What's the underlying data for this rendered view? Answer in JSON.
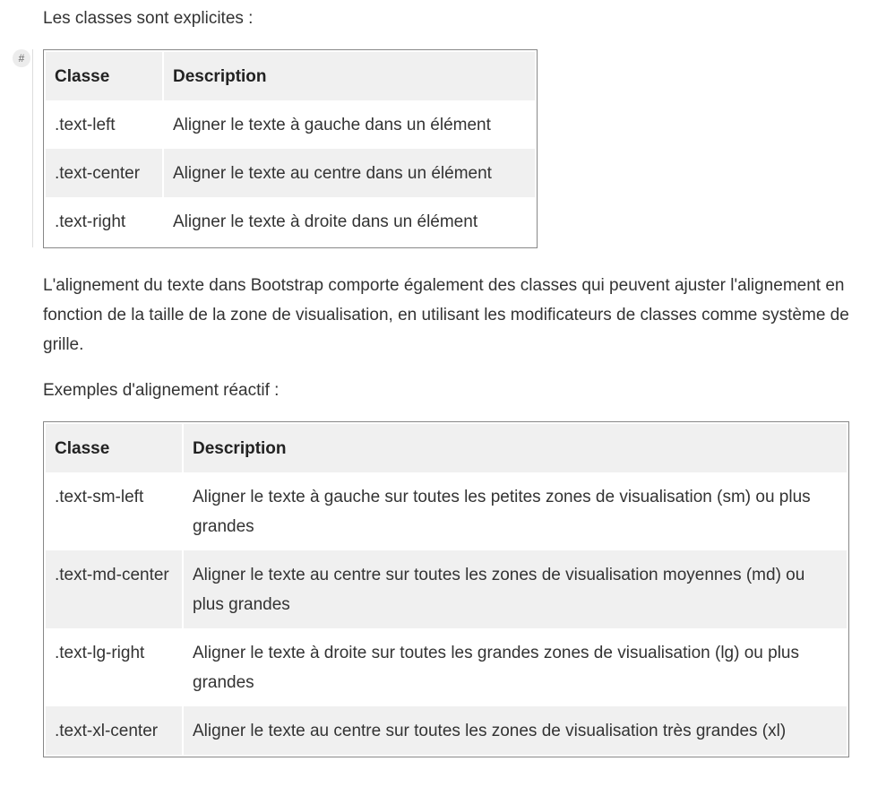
{
  "intro": "Les classes sont explicites :",
  "anchor_badge": "#",
  "table1": {
    "headers": [
      "Classe",
      "Description"
    ],
    "rows": [
      [
        ".text-left",
        "Aligner le texte à gauche dans un élément"
      ],
      [
        ".text-center",
        "Aligner le texte au centre dans un élément"
      ],
      [
        ".text-right",
        "Aligner le texte à droite dans un élément"
      ]
    ]
  },
  "body_paragraph": "L'alignement du texte dans Bootstrap comporte également des classes qui peuvent ajuster l'alignement en fonction de la taille de la zone de visualisation, en utilisant les modificateurs de classes comme système de grille.",
  "examples_intro": "Exemples d'alignement réactif :",
  "table2": {
    "headers": [
      "Classe",
      "Description"
    ],
    "rows": [
      [
        ".text-sm-left",
        "Aligner le texte à gauche sur toutes les petites zones de visualisation (sm) ou plus grandes"
      ],
      [
        ".text-md-center",
        "Aligner le texte au centre sur toutes les zones de visualisation moyennes (md) ou plus grandes"
      ],
      [
        ".text-lg-right",
        "Aligner le texte à droite sur toutes les grandes zones de visualisation (lg) ou plus grandes"
      ],
      [
        ".text-xl-center",
        "Aligner le texte au centre sur toutes les zones de visualisation très grandes (xl)"
      ]
    ]
  }
}
